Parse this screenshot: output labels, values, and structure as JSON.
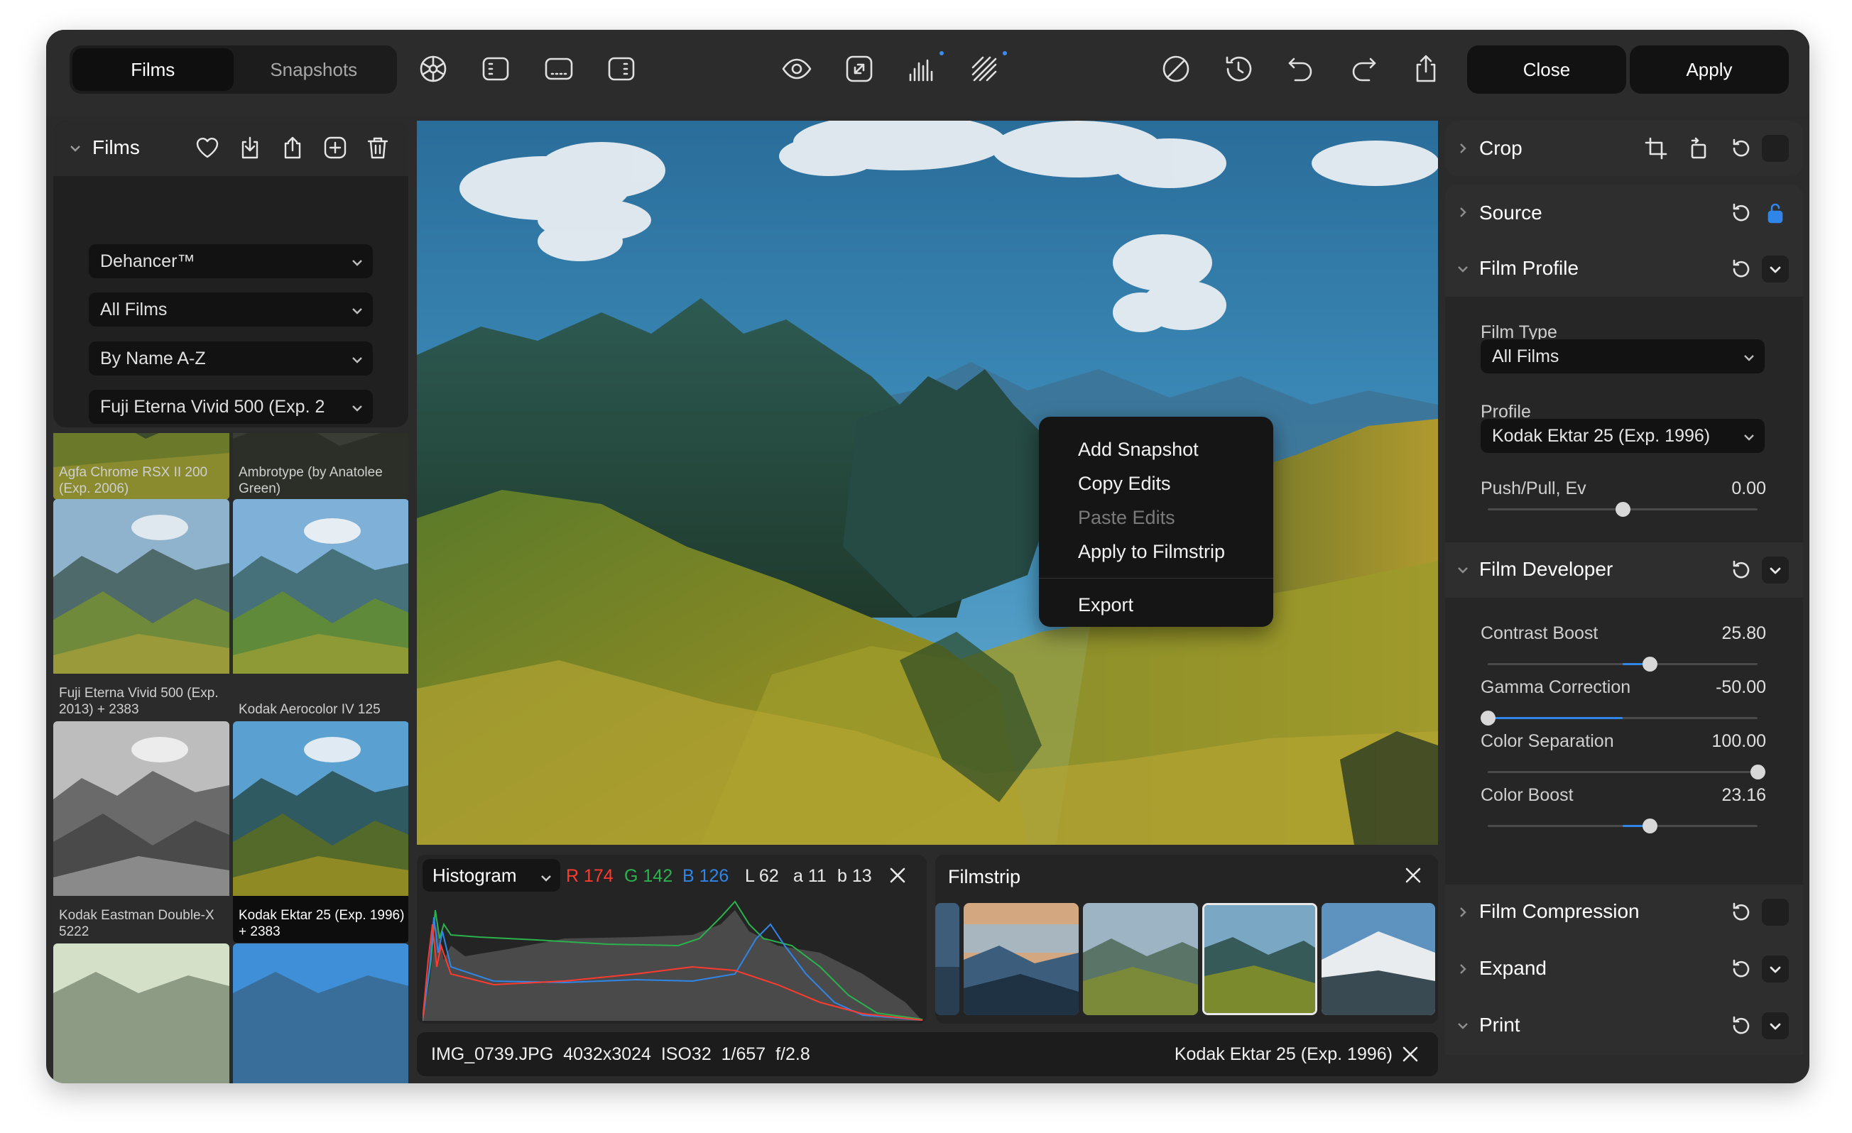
{
  "topbar": {
    "tabs": [
      {
        "label": "Films",
        "active": true
      },
      {
        "label": "Snapshots",
        "active": false
      }
    ],
    "close_label": "Close",
    "apply_label": "Apply",
    "icons": [
      "settings-icon",
      "panel-layout-icon",
      "filmstrip-icon",
      "grid-icon",
      "eye-icon",
      "fullscreen-icon",
      "histogram-icon",
      "grain-icon",
      "bypass-icon",
      "history-icon",
      "undo-icon",
      "redo-icon",
      "share-icon"
    ],
    "accent": "#2f86e8"
  },
  "films_panel": {
    "title": "Films",
    "dropdowns": [
      "Dehancer™",
      "All Films",
      "By Name A-Z",
      "Fuji Eterna Vivid 500 (Exp. 2"
    ],
    "tiles": [
      {
        "caption": "Agfa Chrome RSX II 200 (Exp. 2006)"
      },
      {
        "caption": "Ambrotype (by Anatolee Green)"
      },
      {
        "caption": "Fuji Eterna Vivid 500 (Exp. 2013) + 2383"
      },
      {
        "caption": "Kodak Aerocolor IV 125"
      },
      {
        "caption": "Kodak Eastman Double-X 5222"
      },
      {
        "caption": "Kodak Ektar 25 (Exp. 1996) + 2383"
      },
      {
        "caption": ""
      },
      {
        "caption": ""
      }
    ]
  },
  "context_menu": {
    "items": [
      {
        "label": "Add Snapshot",
        "enabled": true
      },
      {
        "label": "Copy Edits",
        "enabled": true
      },
      {
        "label": "Paste Edits",
        "enabled": false
      },
      {
        "label": "Apply to Filmstrip",
        "enabled": true
      },
      {
        "label": "Export",
        "enabled": true
      }
    ]
  },
  "histogram": {
    "mode": "Histogram",
    "r": "R 174",
    "g": "G 142",
    "b": "B 126",
    "l": "L 62",
    "a": "a 11",
    "bb": "b 13",
    "colors": {
      "r": "#ff3b30",
      "g": "#2bb24c",
      "b": "#2f86e8"
    }
  },
  "filmstrip": {
    "title": "Filmstrip",
    "selected_index": 2
  },
  "infobar": {
    "file": "IMG_0739.JPG",
    "dims": "4032x3024",
    "iso": "ISO32",
    "shutter": "1/657",
    "aperture": "f/2.8",
    "profile": "Kodak Ektar 25 (Exp. 1996)"
  },
  "right_panel": {
    "crop": {
      "title": "Crop"
    },
    "source": {
      "title": "Source"
    },
    "film_profile": {
      "title": "Film Profile",
      "film_type_label": "Film Type",
      "film_type_value": "All Films",
      "profile_label": "Profile",
      "profile_value": "Kodak Ektar 25 (Exp. 1996)",
      "push_pull_label": "Push/Pull, Ev",
      "push_pull_value": "0.00",
      "push_pull_level": 0.5
    },
    "film_developer": {
      "title": "Film Developer",
      "sliders": [
        {
          "label": "Contrast Boost",
          "value": "25.80",
          "level": 0.6,
          "fill_from": 0.5
        },
        {
          "label": "Gamma Correction",
          "value": "-50.00",
          "level": 0.0,
          "fill_from": 0.5
        },
        {
          "label": "Color Separation",
          "value": "100.00",
          "level": 1.0,
          "fill_from": 1.0
        },
        {
          "label": "Color Boost",
          "value": "23.16",
          "level": 0.6,
          "fill_from": 0.5
        }
      ]
    },
    "film_compression": {
      "title": "Film Compression"
    },
    "expand": {
      "title": "Expand"
    },
    "print": {
      "title": "Print"
    }
  }
}
